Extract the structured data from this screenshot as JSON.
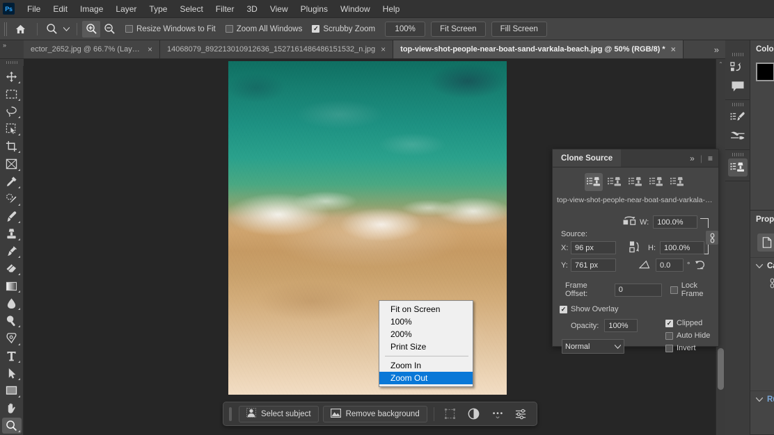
{
  "app": {
    "logo": "Ps"
  },
  "menubar": {
    "items": [
      "File",
      "Edit",
      "Image",
      "Layer",
      "Type",
      "Select",
      "Filter",
      "3D",
      "View",
      "Plugins",
      "Window",
      "Help"
    ]
  },
  "options_bar": {
    "home_icon": "home-icon",
    "tool_preset_icon": "zoom-tool-icon",
    "zoom_in_icon": "zoom-in-icon",
    "zoom_out_icon": "zoom-out-icon",
    "checkboxes": [
      {
        "label": "Resize Windows to Fit",
        "checked": false
      },
      {
        "label": "Zoom All Windows",
        "checked": false
      },
      {
        "label": "Scrubby Zoom",
        "checked": true
      }
    ],
    "buttons": [
      "100%",
      "Fit Screen",
      "Fill Screen"
    ]
  },
  "tabs": {
    "items": [
      {
        "title": "ector_2652.jpg @ 66.7% (Layer...",
        "active": false,
        "close": "×"
      },
      {
        "title": "14068079_892213010912636_1527161486486151532_n.jpg",
        "active": false,
        "close": "×"
      },
      {
        "title": "top-view-shot-people-near-boat-sand-varkala-beach.jpg @ 50% (RGB/8) *",
        "active": true,
        "close": "×"
      }
    ],
    "overflow_icon": "»",
    "corner_icon": "»"
  },
  "toolbar": {
    "tools": [
      {
        "name": "move-tool",
        "active": false
      },
      {
        "name": "rectangular-marquee-tool",
        "active": false
      },
      {
        "name": "lasso-tool",
        "active": false
      },
      {
        "name": "object-selection-tool",
        "active": false
      },
      {
        "name": "crop-tool",
        "active": false
      },
      {
        "name": "frame-tool",
        "active": false
      },
      {
        "name": "eyedropper-tool",
        "active": false
      },
      {
        "name": "spot-healing-brush-tool",
        "active": false
      },
      {
        "name": "brush-tool",
        "active": false
      },
      {
        "name": "clone-stamp-tool",
        "active": false
      },
      {
        "name": "history-brush-tool",
        "active": false
      },
      {
        "name": "eraser-tool",
        "active": false
      },
      {
        "name": "gradient-tool",
        "active": false
      },
      {
        "name": "blur-tool",
        "active": false
      },
      {
        "name": "dodge-tool",
        "active": false
      },
      {
        "name": "pen-tool",
        "active": false
      },
      {
        "name": "type-tool",
        "active": false
      },
      {
        "name": "path-selection-tool",
        "active": false
      },
      {
        "name": "rectangle-tool",
        "active": false
      },
      {
        "name": "hand-tool",
        "active": false
      },
      {
        "name": "zoom-tool",
        "active": true
      }
    ]
  },
  "context_menu": {
    "items": [
      {
        "label": "Fit on Screen",
        "selected": false
      },
      {
        "label": "100%",
        "selected": false
      },
      {
        "label": "200%",
        "selected": false
      },
      {
        "label": "Print Size",
        "selected": false
      },
      {
        "separator": true
      },
      {
        "label": "Zoom In",
        "selected": false
      },
      {
        "label": "Zoom Out",
        "selected": true
      }
    ],
    "highlight_color": "#0a78d7"
  },
  "task_bar": {
    "select_subject": "Select subject",
    "remove_background": "Remove background",
    "icons": [
      "transform-icon",
      "adjustment-icon",
      "more-options-icon",
      "settings-icon"
    ]
  },
  "clone_source": {
    "title": "Clone Source",
    "collapse_icon": "»",
    "menu_icon": "≡",
    "stamp_count": 5,
    "active_stamp": 1,
    "filename": "top-view-shot-people-near-boat-sand-varkala-bea...",
    "source_label": "Source:",
    "x_label": "X:",
    "x_value": "96 px",
    "y_label": "Y:",
    "y_value": "761 px",
    "w_label": "W:",
    "w_value": "100.0%",
    "h_label": "H:",
    "h_value": "100.0%",
    "angle_value": "0.0",
    "angle_unit": "°",
    "reset_icon": "reset-icon",
    "flip_h_icon": "flip-horizontal-icon",
    "flip_v_icon": "flip-vertical-icon",
    "link_icon": "link-icon",
    "frame_offset_label": "Frame Offset:",
    "frame_offset_value": "0",
    "lock_frame_label": "Lock Frame",
    "lock_frame_checked": false,
    "show_overlay_label": "Show Overlay",
    "show_overlay_checked": true,
    "opacity_label": "Opacity:",
    "opacity_value": "100%",
    "blend_mode": "Normal",
    "clipped_label": "Clipped",
    "clipped_checked": true,
    "auto_hide_label": "Auto Hide",
    "auto_hide_checked": false,
    "invert_label": "Invert",
    "invert_checked": false
  },
  "right_dock": {
    "collapse_icon": "«",
    "icons": [
      {
        "name": "history-icon",
        "active": false
      },
      {
        "name": "comments-icon",
        "active": false
      },
      {
        "name": "brush-settings-icon",
        "active": false
      },
      {
        "name": "brushes-icon",
        "active": false
      },
      {
        "name": "clone-source-icon",
        "active": true
      }
    ],
    "panels": [
      {
        "title": "Color",
        "name": "color-panel"
      },
      {
        "title": "Prope",
        "name": "properties-panel"
      }
    ],
    "properties_sections": [
      {
        "title": "Ca",
        "name": "canvas-section"
      },
      {
        "title": "Ru",
        "name": "rulers-section"
      }
    ],
    "foreground_color": "#000000",
    "background_color": "#ffffff"
  },
  "canvas": {
    "scrollbar_up_icon": "⌃",
    "background_color": "#262626"
  }
}
